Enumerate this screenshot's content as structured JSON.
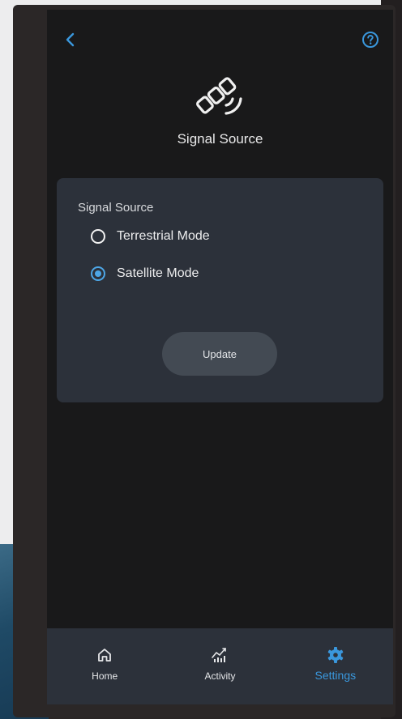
{
  "header": {
    "back_icon": "chevron-left-icon",
    "help_icon": "question-circle-icon",
    "feature_icon": "satellite-icon",
    "title": "Signal Source"
  },
  "card": {
    "title": "Signal Source",
    "options": [
      {
        "label": "Terrestrial Mode",
        "selected": false
      },
      {
        "label": "Satellite Mode",
        "selected": true
      }
    ],
    "update_label": "Update"
  },
  "nav": {
    "items": [
      {
        "label": "Home",
        "icon": "home-icon",
        "active": false
      },
      {
        "label": "Activity",
        "icon": "activity-icon",
        "active": false
      },
      {
        "label": "Settings",
        "icon": "gear-icon",
        "active": true
      }
    ]
  },
  "colors": {
    "accent": "#3a97dc",
    "screen_bg": "#19191a",
    "card_bg": "#2c313a"
  }
}
